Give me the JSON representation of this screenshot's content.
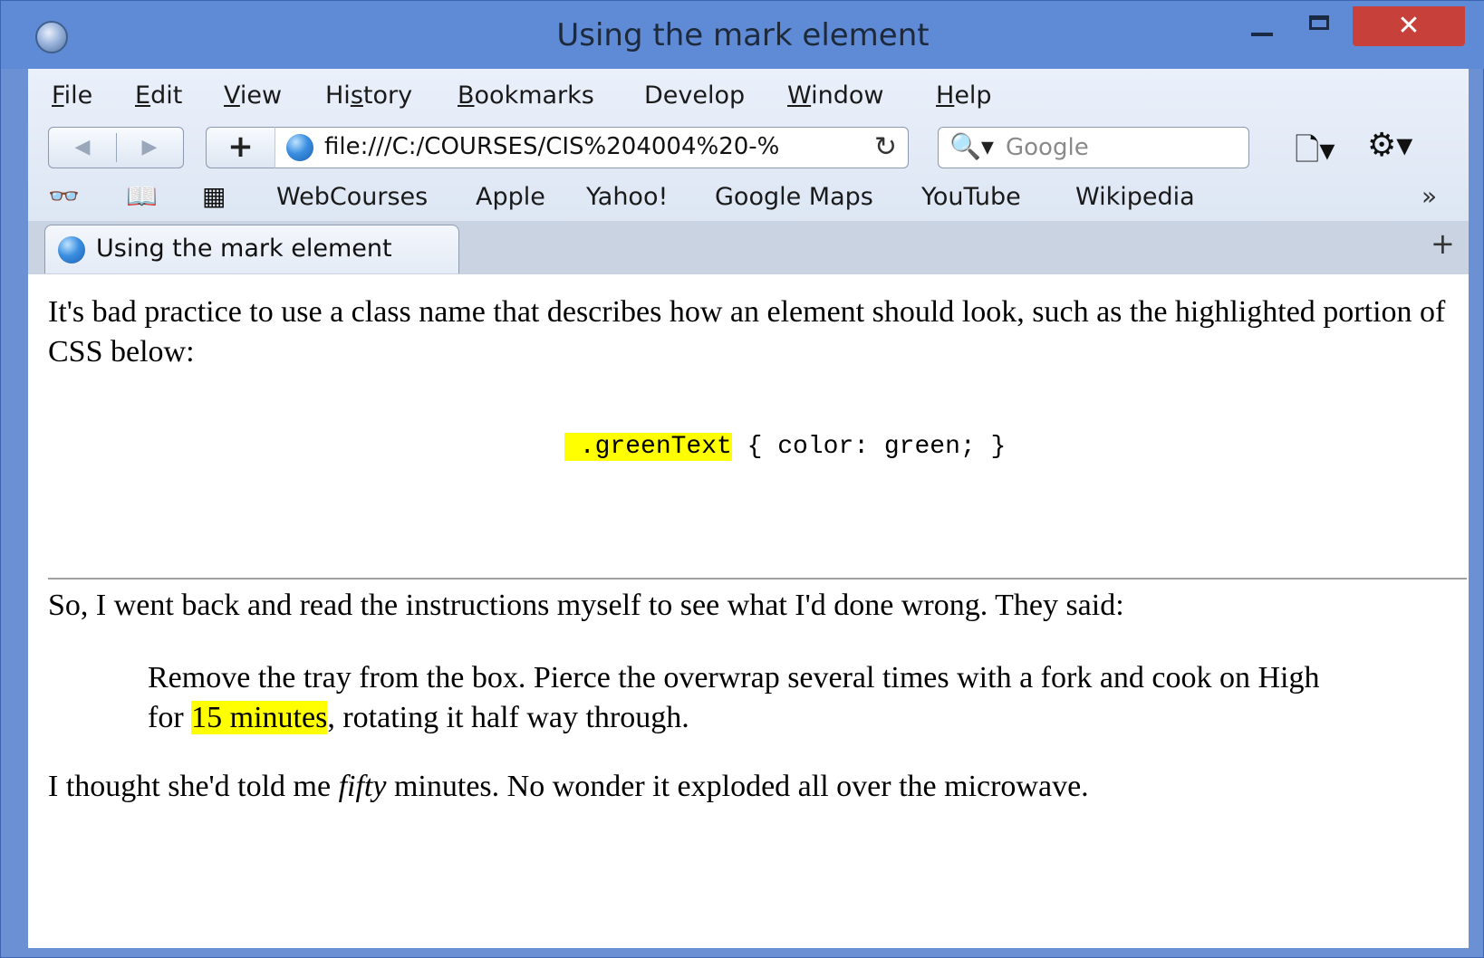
{
  "window": {
    "title": "Using the mark element",
    "close_glyph": "✕"
  },
  "menu": {
    "file": {
      "u": "F",
      "rest": "ile"
    },
    "edit": {
      "u": "E",
      "rest": "dit"
    },
    "view": {
      "u": "V",
      "rest": "iew"
    },
    "history": {
      "pre": "Hi",
      "u": "s",
      "rest": "tory"
    },
    "bookmarks": {
      "u": "B",
      "rest": "ookmarks"
    },
    "develop": "Develop",
    "window": {
      "u": "W",
      "rest": "indow"
    },
    "help": {
      "u": "H",
      "rest": "elp"
    }
  },
  "toolbar": {
    "back_glyph": "◀",
    "forward_glyph": "▶",
    "new_tab_glyph": "+",
    "url": "file:///C:/COURSES/CIS%204004%20-%",
    "reload_glyph": "↻",
    "search_glyph": "🔍▾",
    "search_placeholder": "Google",
    "page_menu_glyph": "🗋▾",
    "settings_glyph": "⚙▾"
  },
  "bookmarks_bar": {
    "reading_list_glyph": "👓",
    "bookmarks_glyph": "📖",
    "top_sites_glyph": "▦",
    "links": [
      "WebCourses",
      "Apple",
      "Yahoo!",
      "Google Maps",
      "YouTube",
      "Wikipedia"
    ],
    "overflow_glyph": "»"
  },
  "tabs": {
    "active_title": "Using the mark element",
    "add_glyph": "+"
  },
  "content": {
    "p1": "It's bad practice to use a class name that describes how an element should look, such as the highlighted portion of CSS below:",
    "code_highlight": " .greenText",
    "code_rest": " { color: green; }",
    "p2": "So, I went back and read the instructions myself to see what I'd done wrong. They said:",
    "bq_before": "Remove the tray from the box. Pierce the overwrap several times with a fork and cook on High for ",
    "bq_mark": "15 minutes",
    "bq_after": ", rotating it half way through.",
    "p3_before": "I thought she'd told me ",
    "p3_em": "fifty",
    "p3_after": " minutes. No wonder it exploded all over the microwave."
  },
  "colors": {
    "titlebar": "#5f8ad6",
    "highlight": "#ffff00",
    "close_button": "#c8403a"
  }
}
